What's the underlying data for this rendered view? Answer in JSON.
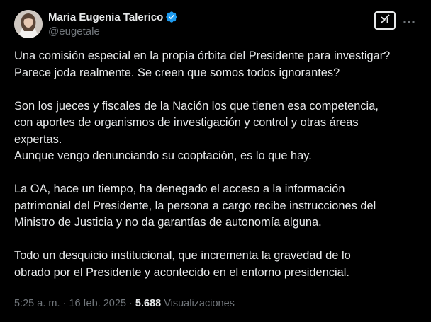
{
  "author": {
    "display_name": "Maria Eugenia Talerico",
    "handle": "@eugetale",
    "verified": true,
    "verified_icon": "verified-badge-icon",
    "verified_color": "#1d9bf0"
  },
  "actions": {
    "grok_icon": "grok-icon",
    "more_icon": "more-options-icon"
  },
  "tweet": {
    "paragraphs": [
      "Una comisión especial en la propia órbita del Presidente para investigar?\nParece joda realmente. Se creen que somos todos ignorantes?",
      "Son los jueces y fiscales de la Nación los que tienen esa competencia,\ncon aportes de organismos de investigación y control y otras áreas\nexpertas.\nAunque vengo denunciando su cooptación, es lo que hay.",
      "La OA, hace un tiempo, ha denegado el acceso a la información\npatrimonial del Presidente, la persona a cargo recibe instrucciones del\nMinistro de Justicia y no da garantías de autonomía alguna.",
      "Todo un desquicio institucional, que incrementa la gravedad de lo\nobrado por el Presidente y acontecido en el entorno presidencial."
    ]
  },
  "meta": {
    "time": "5:25 a. m.",
    "separator": " · ",
    "date": "16 feb. 2025",
    "views_count": "5.688",
    "views_label": " Visualizaciones"
  },
  "colors": {
    "background": "#000000",
    "text": "#e7e9ea",
    "secondary": "#71767b",
    "accent": "#1d9bf0"
  }
}
